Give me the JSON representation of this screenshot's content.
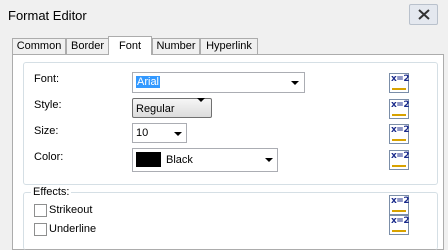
{
  "window": {
    "title": "Format Editor"
  },
  "tabs": [
    "Common",
    "Border",
    "Font",
    "Number",
    "Hyperlink"
  ],
  "font_section": {
    "font_label": "Font:",
    "font_value": "Arial",
    "style_label": "Style:",
    "style_value": "Regular",
    "size_label": "Size:",
    "size_value": "10",
    "color_label": "Color:",
    "color_value": "Black",
    "color_hex": "#000000"
  },
  "effects": {
    "label": "Effects:",
    "strikeout_label": "Strikeout",
    "strikeout_checked": false,
    "underline_label": "Underline",
    "underline_checked": false
  },
  "expression_button": {
    "icon_text": "x=2"
  }
}
